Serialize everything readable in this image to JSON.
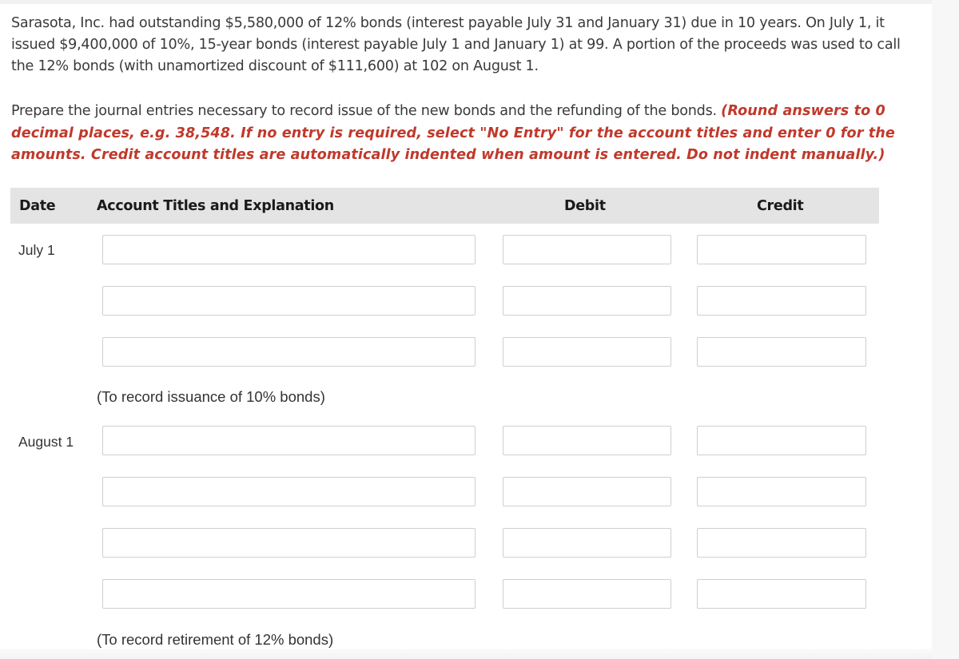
{
  "problem": {
    "text": "Sarasota, Inc. had outstanding $5,580,000 of 12% bonds (interest payable July 31 and January 31) due in 10 years. On July 1, it issued $9,400,000 of 10%, 15-year bonds (interest payable July 1 and January 1) at 99. A portion of the proceeds was used to call the 12% bonds (with unamortized discount of $111,600) at 102 on August 1."
  },
  "instructions": {
    "text": "Prepare the journal entries necessary to record issue of the new bonds and the refunding of the bonds. ",
    "note": "(Round answers to 0 decimal places, e.g. 38,548. If no entry is required, select \"No Entry\" for the account titles and enter 0 for the amounts. Credit account titles are automatically indented when amount is entered. Do not indent manually.)",
    "note_color": "#c0392b"
  },
  "table": {
    "headers": {
      "date": "Date",
      "account": "Account Titles and Explanation",
      "debit": "Debit",
      "credit": "Credit"
    },
    "entries": [
      {
        "date": "July 1",
        "rows": [
          {
            "account": "",
            "debit": "",
            "credit": ""
          },
          {
            "account": "",
            "debit": "",
            "credit": ""
          },
          {
            "account": "",
            "debit": "",
            "credit": ""
          }
        ],
        "explanation": "(To record issuance of 10% bonds)"
      },
      {
        "date": "August 1",
        "rows": [
          {
            "account": "",
            "debit": "",
            "credit": ""
          },
          {
            "account": "",
            "debit": "",
            "credit": ""
          },
          {
            "account": "",
            "debit": "",
            "credit": ""
          },
          {
            "account": "",
            "debit": "",
            "credit": ""
          }
        ],
        "explanation": "(To record retirement of 12% bonds)"
      }
    ]
  }
}
